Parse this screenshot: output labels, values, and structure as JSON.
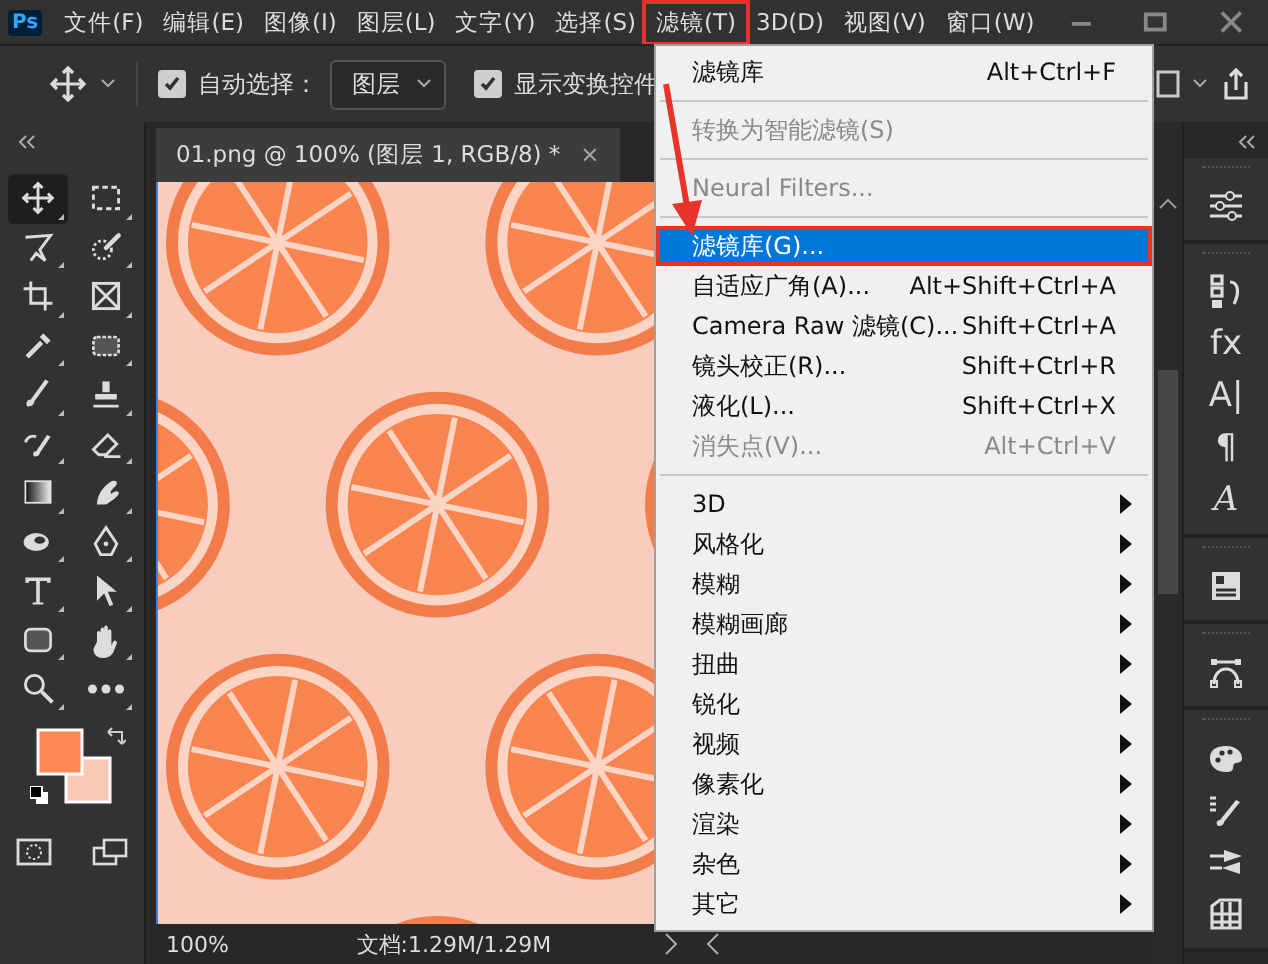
{
  "app_logo": "Ps",
  "menubar": [
    {
      "label": "文件(F)",
      "open": false
    },
    {
      "label": "编辑(E)",
      "open": false
    },
    {
      "label": "图像(I)",
      "open": false
    },
    {
      "label": "图层(L)",
      "open": false
    },
    {
      "label": "文字(Y)",
      "open": false
    },
    {
      "label": "选择(S)",
      "open": false
    },
    {
      "label": "滤镜(T)",
      "open": true
    },
    {
      "label": "3D(D)",
      "open": false
    },
    {
      "label": "视图(V)",
      "open": false
    },
    {
      "label": "窗口(W)",
      "open": false
    }
  ],
  "options_bar": {
    "auto_select": {
      "label": "自动选择：",
      "checked": true
    },
    "layer_dropdown": {
      "value": "图层"
    },
    "show_transform": {
      "label": "显示变换控件",
      "checked": true
    }
  },
  "tools": [
    {
      "kind": "move",
      "selected": true
    },
    {
      "kind": "marquee",
      "selected": false
    },
    {
      "kind": "lasso",
      "selected": false
    },
    {
      "kind": "quick-select",
      "selected": false
    },
    {
      "kind": "crop",
      "selected": false
    },
    {
      "kind": "frame",
      "selected": false
    },
    {
      "kind": "eyedropper",
      "selected": false
    },
    {
      "kind": "patch",
      "selected": false
    },
    {
      "kind": "brush",
      "selected": false
    },
    {
      "kind": "stamp",
      "selected": false
    },
    {
      "kind": "history-brush",
      "selected": false
    },
    {
      "kind": "eraser",
      "selected": false
    },
    {
      "kind": "gradient",
      "selected": false
    },
    {
      "kind": "smudge",
      "selected": false
    },
    {
      "kind": "dodge",
      "selected": false
    },
    {
      "kind": "pen",
      "selected": false
    },
    {
      "kind": "type",
      "selected": false
    },
    {
      "kind": "path-select",
      "selected": false
    },
    {
      "kind": "shape",
      "selected": false
    },
    {
      "kind": "hand",
      "selected": false
    },
    {
      "kind": "zoom",
      "selected": false
    },
    {
      "kind": "more",
      "selected": false
    }
  ],
  "document_tab": {
    "title": "01.png @ 100% (图层 1, RGB/8) *",
    "close": "×"
  },
  "status_bar": {
    "zoom": "100%",
    "doc_info": "文档:1.29M/1.29M"
  },
  "panel_groups": [
    {
      "items": [
        {
          "kind": "adjustments"
        }
      ]
    },
    {
      "items": [
        {
          "kind": "history"
        },
        {
          "kind": "glyph",
          "text": "fx"
        },
        {
          "kind": "glyph",
          "text": "A|"
        },
        {
          "kind": "glyph",
          "text": "¶"
        },
        {
          "kind": "script-glyph",
          "text": "A"
        }
      ]
    },
    {
      "items": [
        {
          "kind": "properties"
        }
      ]
    },
    {
      "items": [
        {
          "kind": "paths"
        }
      ]
    },
    {
      "items": [
        {
          "kind": "color"
        },
        {
          "kind": "brushes"
        },
        {
          "kind": "brush-settings"
        },
        {
          "kind": "swatches"
        }
      ]
    }
  ],
  "filter_menu": {
    "items": [
      {
        "kind": "item",
        "label": "滤镜库",
        "shortcut": "Alt+Ctrl+F",
        "disabled": false,
        "selected": false
      },
      {
        "kind": "separator"
      },
      {
        "kind": "item",
        "label": "转换为智能滤镜(S)",
        "disabled": true,
        "selected": false
      },
      {
        "kind": "separator"
      },
      {
        "kind": "item",
        "label": "Neural Filters...",
        "disabled": true,
        "selected": false
      },
      {
        "kind": "separator"
      },
      {
        "kind": "item",
        "label": "滤镜库(G)...",
        "disabled": false,
        "selected": true
      },
      {
        "kind": "item",
        "label": "自适应广角(A)...",
        "shortcut": "Alt+Shift+Ctrl+A",
        "disabled": false,
        "selected": false
      },
      {
        "kind": "item",
        "label": "Camera Raw 滤镜(C)...",
        "shortcut": "Shift+Ctrl+A",
        "disabled": false,
        "selected": false
      },
      {
        "kind": "item",
        "label": "镜头校正(R)...",
        "shortcut": "Shift+Ctrl+R",
        "disabled": false,
        "selected": false
      },
      {
        "kind": "item",
        "label": "液化(L)...",
        "shortcut": "Shift+Ctrl+X",
        "disabled": false,
        "selected": false
      },
      {
        "kind": "item",
        "label": "消失点(V)...",
        "shortcut": "Alt+Ctrl+V",
        "disabled": true,
        "selected": false
      },
      {
        "kind": "separator"
      },
      {
        "kind": "submenu",
        "label": "3D",
        "disabled": false,
        "selected": false
      },
      {
        "kind": "submenu",
        "label": "风格化",
        "disabled": false,
        "selected": false
      },
      {
        "kind": "submenu",
        "label": "模糊",
        "disabled": false,
        "selected": false
      },
      {
        "kind": "submenu",
        "label": "模糊画廊",
        "disabled": false,
        "selected": false
      },
      {
        "kind": "submenu",
        "label": "扭曲",
        "disabled": false,
        "selected": false
      },
      {
        "kind": "submenu",
        "label": "锐化",
        "disabled": false,
        "selected": false
      },
      {
        "kind": "submenu",
        "label": "视频",
        "disabled": false,
        "selected": false
      },
      {
        "kind": "submenu",
        "label": "像素化",
        "disabled": false,
        "selected": false
      },
      {
        "kind": "submenu",
        "label": "渲染",
        "disabled": false,
        "selected": false
      },
      {
        "kind": "submenu",
        "label": "杂色",
        "disabled": false,
        "selected": false
      },
      {
        "kind": "submenu",
        "label": "其它",
        "disabled": false,
        "selected": false
      }
    ]
  }
}
